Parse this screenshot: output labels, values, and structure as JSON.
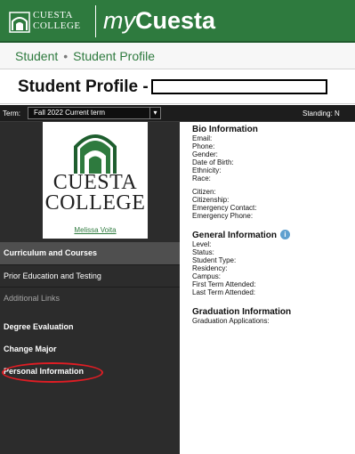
{
  "header": {
    "logo": {
      "line1": "CUESTA",
      "line2": "COLLEGE"
    },
    "app_title_prefix": "my",
    "app_title_brand": "Cuesta"
  },
  "breadcrumb": {
    "items": [
      "Student",
      "Student Profile"
    ],
    "separator": "•"
  },
  "page": {
    "title": "Student Profile -"
  },
  "term_bar": {
    "label": "Term:",
    "selected_term": "Fall 2022 Current term",
    "caret": "▾",
    "standing_label": "Standing: N"
  },
  "profile": {
    "logo": {
      "line1": "CUESTA",
      "line2": "COLLEGE"
    },
    "name": "Melissa Voita"
  },
  "nav": {
    "items": [
      {
        "label": "Curriculum and Courses"
      },
      {
        "label": "Prior Education and Testing"
      },
      {
        "label": "Additional Links"
      },
      {
        "label": "Degree Evaluation"
      },
      {
        "label": "Change Major"
      },
      {
        "label": "Personal Information"
      }
    ]
  },
  "bio": {
    "title": "Bio Information",
    "fields": [
      "Email:",
      "Phone:",
      "Gender:",
      "Date of Birth:",
      "Ethnicity:",
      "Race:"
    ],
    "fields2": [
      "Citizen:",
      "Citizenship:",
      "Emergency Contact:",
      "Emergency Phone:"
    ]
  },
  "general": {
    "title": "General Information",
    "info_icon": "i",
    "fields": [
      "Level:",
      "Status:",
      "Student Type:",
      "Residency:",
      "Campus:",
      "First Term Attended:",
      "Last Term Attended:"
    ]
  },
  "graduation": {
    "title": "Graduation Information",
    "fields": [
      "Graduation Applications:"
    ]
  },
  "colors": {
    "brand_green": "#2e7a3e",
    "sidebar_bg": "#2c2c2c",
    "highlight_red": "#e01d24",
    "info_blue": "#5fa0cf"
  }
}
